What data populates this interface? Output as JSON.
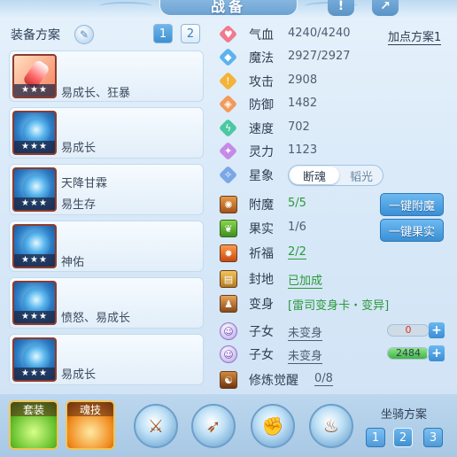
{
  "header": {
    "title": "战备",
    "help_icon": "exclamation-icon",
    "share_icon": "share-icon"
  },
  "loadout": {
    "title": "装备方案",
    "edit_icon": "pencil-icon",
    "tabs": [
      {
        "label": "1",
        "active": true
      },
      {
        "label": "2",
        "active": false
      }
    ],
    "stars": "★★★",
    "cards": [
      {
        "line1": "",
        "line2": "易成长、狂暴"
      },
      {
        "line1": "",
        "line2": "易成长"
      },
      {
        "line1": "天降甘霖",
        "line2": "易生存"
      },
      {
        "line1": "",
        "line2": "神佑"
      },
      {
        "line1": "",
        "line2": "愤怒、易成长"
      },
      {
        "line1": "",
        "line2": "易成长"
      }
    ]
  },
  "attributes": {
    "plan_link": "加点方案1",
    "hp": {
      "label": "气血",
      "value": "4240/4240",
      "icon": "heart-icon"
    },
    "mp": {
      "label": "魔法",
      "value": "2927/2927",
      "icon": "mana-icon"
    },
    "atk": {
      "label": "攻击",
      "value": "2908",
      "icon": "attack-icon"
    },
    "def": {
      "label": "防御",
      "value": "1482",
      "icon": "shield-icon"
    },
    "spd": {
      "label": "速度",
      "value": "702",
      "icon": "speed-icon"
    },
    "spi": {
      "label": "灵力",
      "value": "1123",
      "icon": "spirit-icon"
    },
    "constellation": {
      "label": "星象",
      "icon": "star-icon",
      "options": [
        "断魂",
        "韬光"
      ],
      "selected": "断魂"
    }
  },
  "extras": {
    "enchant": {
      "label": "附魔",
      "value": "5/5",
      "button": "一键附魔"
    },
    "fruit": {
      "label": "果实",
      "value": "1/6",
      "button": "一键果实"
    },
    "blessing": {
      "label": "祈福",
      "value": "2/2"
    },
    "seal": {
      "label": "封地",
      "value": "已加成"
    },
    "transform": {
      "label": "变身",
      "value": "[雷司变身卡・变异]"
    },
    "child1": {
      "label": "子女",
      "value": "未变身",
      "bar_text": "0",
      "bar_fraction": 0
    },
    "child2": {
      "label": "子女",
      "value": "未变身",
      "bar_text": "2484",
      "bar_fraction": 0.95
    },
    "cultivation": {
      "label": "修炼觉醒",
      "value": "0/8"
    },
    "plus": "+"
  },
  "bottom": {
    "outfit_label": "套装",
    "skill_label": "魂技",
    "mount": {
      "label": "坐骑方案",
      "options": [
        "1",
        "2",
        "3"
      ],
      "active": "2"
    }
  },
  "colors": {
    "accent": "#3e8fd0",
    "green": "#2b9a3a",
    "frame": "#8f3b2c"
  }
}
